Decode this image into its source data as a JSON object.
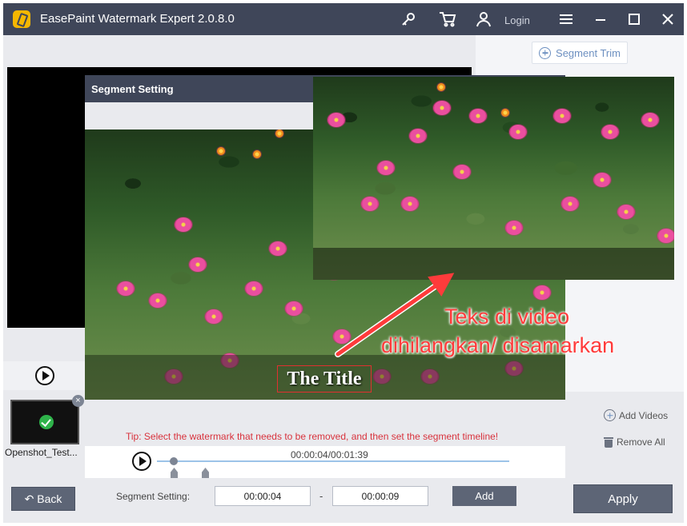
{
  "app": {
    "title": "EasePaint Watermark Expert  2.0.8.0"
  },
  "titlebar": {
    "login_label": "Login"
  },
  "right_panel": {
    "segment_trim_label": "Segment Trim",
    "add_videos_label": "Add Videos",
    "remove_all_label": "Remove All"
  },
  "thumbnail": {
    "filename": "Openshot_Test..."
  },
  "dialog": {
    "title": "Segment Setting",
    "video_title_text": "The Title",
    "annotation_line1": "Teks di video",
    "annotation_line2": "dihilangkan/ disamarkan",
    "tip": "Tip: Select the watermark that needs to be removed, and then set the segment timeline!",
    "time_display": "00:00:04/00:01:39",
    "segment_label": "Segment Setting:",
    "start_time": "00:00:04",
    "dash": "-",
    "end_time": "00:00:09",
    "add_label": "Add"
  },
  "footer": {
    "back_label": "Back",
    "apply_label": "Apply"
  },
  "colors": {
    "titlebar": "#3f4659",
    "accent": "#6c8fc0",
    "tip": "#d8323c",
    "annotation": "#ff3b3b"
  },
  "icons": [
    "app-logo-icon",
    "key-icon",
    "cart-icon",
    "user-icon",
    "menu-icon",
    "minimize-icon",
    "maximize-icon",
    "close-icon",
    "plus-circle-icon",
    "trash-icon",
    "play-icon",
    "check-icon",
    "back-arrow-icon"
  ]
}
